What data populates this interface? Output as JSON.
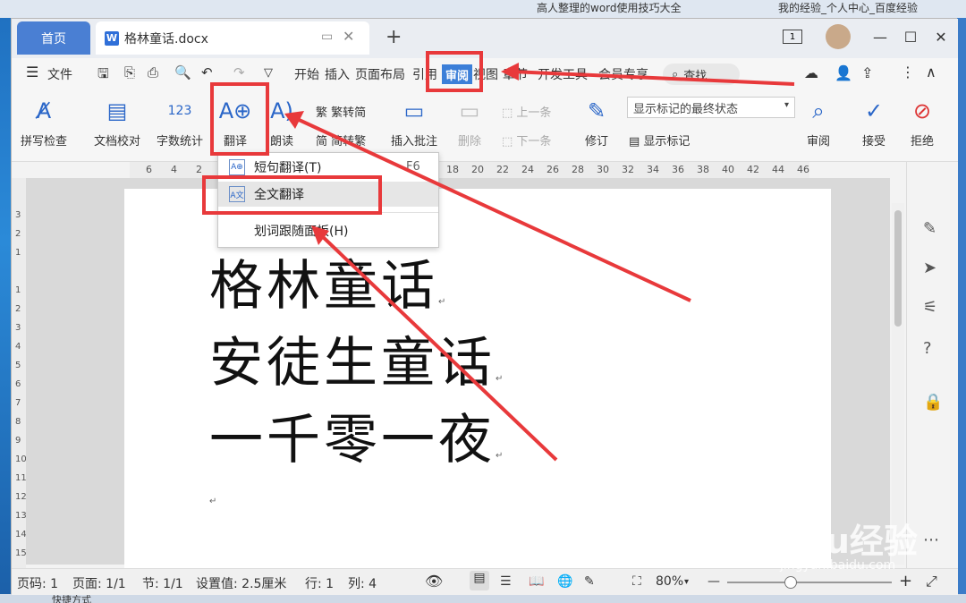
{
  "desktop": {
    "top_texts": [
      "高人整理的word使用技巧大全",
      "我的经验_个人中心_百度经验"
    ],
    "bottom_text": "快捷方式"
  },
  "tabs": {
    "home_label": "首页",
    "doc_label": "格林童话.docx",
    "page_badge": "1"
  },
  "menu": {
    "file_label": "文件",
    "items": [
      "开始",
      "插入",
      "页面布局",
      "引用",
      "审阅",
      "视图",
      "章节",
      "开发工具",
      "会员专享"
    ],
    "active": "审阅",
    "search_label": "查找"
  },
  "ribbon": {
    "spell_check": "拼写检查",
    "doc_proof": "文档校对",
    "word_count": "字数统计",
    "translate": "翻译",
    "read_aloud": "朗读",
    "trad_to_simp": "繁转简",
    "simp_to_trad": "简转繁",
    "insert_comment": "插入批注",
    "delete": "删除",
    "prev": "上一条",
    "next": "下一条",
    "track_changes": "修订",
    "markup_select": "显示标记的最终状态",
    "show_markup": "显示标记",
    "review_pane": "审阅",
    "accept": "接受",
    "reject": "拒绝"
  },
  "translate_menu": {
    "items": [
      {
        "label": "短句翻译(T)",
        "shortcut": "F6"
      },
      {
        "label": "全文翻译",
        "shortcut": ""
      },
      {
        "label": "划词跟随面板(H)",
        "shortcut": ""
      }
    ]
  },
  "ruler": {
    "h_ticks": [
      "6",
      "4",
      "2",
      "",
      "2",
      "4",
      "6",
      "8",
      "10",
      "12",
      "14",
      "16",
      "18",
      "20",
      "22",
      "24",
      "26",
      "28",
      "30",
      "32",
      "34",
      "36",
      "38",
      "40",
      "42",
      "44",
      "46"
    ],
    "v_ticks": [
      "3",
      "2",
      "1",
      "",
      "1",
      "2",
      "3",
      "4",
      "5",
      "6",
      "7",
      "8",
      "9",
      "10",
      "11",
      "12",
      "13",
      "14",
      "15",
      "16"
    ]
  },
  "document": {
    "lines": [
      "格林童话",
      "安徒生童话",
      "一千零一夜"
    ]
  },
  "status": {
    "page_no": "页码: 1",
    "pages": "页面: 1/1",
    "section": "节: 1/1",
    "setting": "设置值: 2.5厘米",
    "row": "行: 1",
    "col": "列: 4",
    "zoom": "80%"
  },
  "watermark": {
    "brand": "Baidu经验",
    "url": "jingyan.baidu.com"
  },
  "colors": {
    "accent": "#3c7fd8",
    "annotation": "#e8393b",
    "home_tab": "#4a7fd3"
  }
}
